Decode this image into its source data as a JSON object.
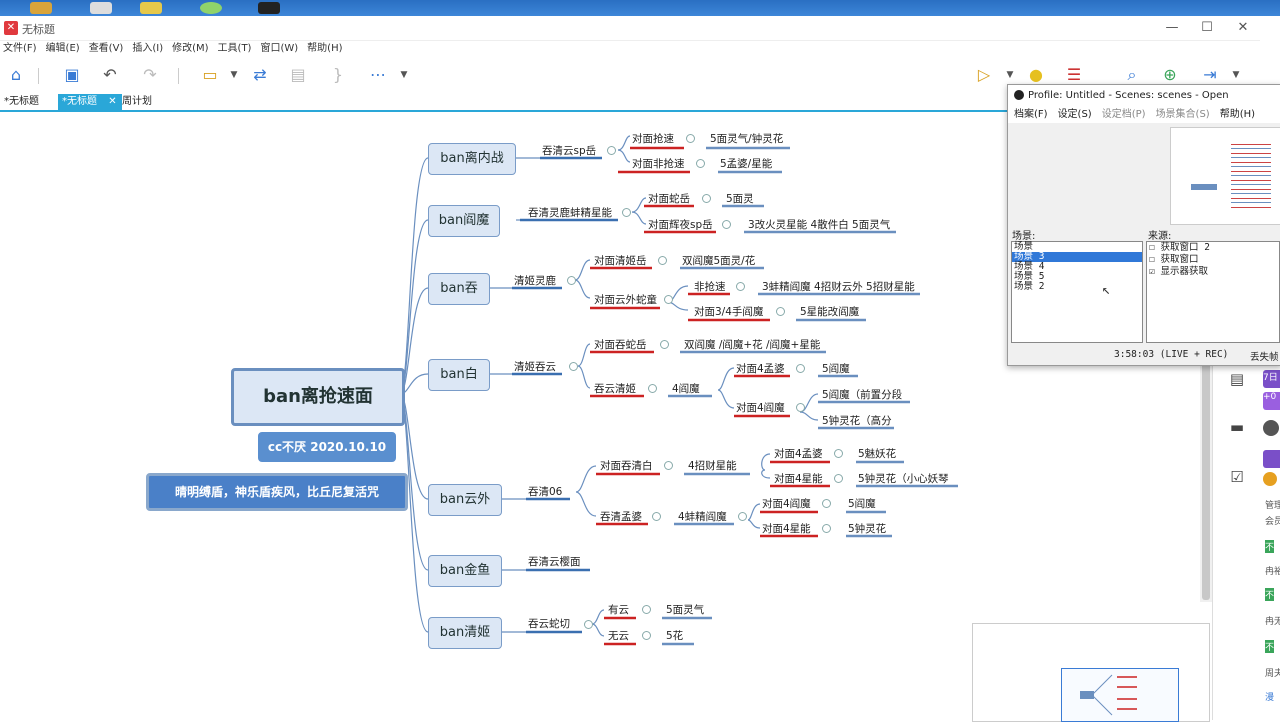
{
  "window": {
    "title": "无标题",
    "minimize": "—",
    "maximize": "☐",
    "close": "✕"
  },
  "menu": [
    "文件(F)",
    "编辑(E)",
    "查看(V)",
    "插入(I)",
    "修改(M)",
    "工具(T)",
    "窗口(W)",
    "帮助(H)"
  ],
  "tabs": [
    "*无标题",
    "*无标题",
    "周计划"
  ],
  "tab_close": "✕",
  "mindmap": {
    "root": "ban离抢速面",
    "sub1": "cc不厌 2020.10.10",
    "sub2": "晴明缚盾，神乐盾疾风，比丘尼复活咒",
    "b1": {
      "name": "ban离内战",
      "c1": "吞清云sp岳",
      "g1": "对面抢速",
      "g1v": "5面灵气/钟灵花",
      "g2": "对面非抢速",
      "g2v": "5孟婆/星能"
    },
    "b2": {
      "name": "ban阎魔",
      "c1": "吞清灵鹿蚌精星能",
      "g1": "对面蛇岳",
      "g1v": "5面灵",
      "g2": "对面辉夜sp岳",
      "g2v": "3改火灵星能 4散件白 5面灵气"
    },
    "b3": {
      "name": "ban吞",
      "c1": "清姬灵鹿",
      "g1": "对面清姬岳",
      "g1v": "双阎魔5面灵/花",
      "g2": "对面云外蛇童",
      "g2a": "非抢速",
      "g2av": "3蚌精阎魔 4招财云外 5招财星能",
      "g2b": "对面3/4手阎魔",
      "g2bv": "5星能改阎魔"
    },
    "b4": {
      "name": "ban白",
      "c1": "清姬吞云",
      "g1": "对面吞蛇岳",
      "g1v": "双阎魔 /阎魔+花 /阎魔+星能",
      "g2": "吞云清姬",
      "g2v": "4阎魔",
      "g2a": "对面4孟婆",
      "g2av": "5阎魔",
      "g2b": "对面4阎魔",
      "g2b1": "5阎魔（前置分段",
      "g2b2": "5钟灵花（高分"
    },
    "b5": {
      "name": "ban云外",
      "c1": "吞清06",
      "g1": "对面吞清白",
      "g1v": "4招财星能",
      "g1a": "对面4孟婆",
      "g1av": "5魅妖花",
      "g1b": "对面4星能",
      "g1bv": "5钟灵花（小心妖琴",
      "g2": "吞清孟婆",
      "g2v": "4蚌精阎魔",
      "g2a": "对面4阎魔",
      "g2av": "5阎魔",
      "g2b": "对面4星能",
      "g2bv": "5钟灵花"
    },
    "b6": {
      "name": "ban金鱼",
      "c1": "吞清云樱面"
    },
    "b7": {
      "name": "ban清姬",
      "c1": "吞云蛇切",
      "g1": "有云",
      "g1v": "5面灵气",
      "g2": "无云",
      "g2v": "5花"
    }
  },
  "obs": {
    "title": "Profile: Untitled - Scenes: scenes - Open Broadcaster S",
    "menu": [
      "档案(F)",
      "设定(S)",
      "设定档(P)",
      "场景集合(S)",
      "帮助(H)"
    ],
    "scenes_label": "场景:",
    "scenes": [
      "场景",
      "场景 3",
      "场景 4",
      "场景 5",
      "场景 2"
    ],
    "sources_label": "来源:",
    "sources": [
      {
        "name": "获取窗口 2",
        "checked": false
      },
      {
        "name": "获取窗口",
        "checked": false
      },
      {
        "name": "显示器获取",
        "checked": true
      }
    ],
    "status": "3:58:03 (LIVE + REC)",
    "dropped": "丢失帧"
  },
  "sidebar_partial": [
    "7日",
    "+0",
    "管理",
    "会员",
    "不",
    "冉裕",
    "不",
    "冉无",
    "不",
    "周夫",
    "漫"
  ],
  "colors": {
    "node_fill": "#dce7f5",
    "node_border": "#7a9cc8",
    "line": "#6a8fbf",
    "accent_red": "#cc2222",
    "accent_blue": "#3a7bd5"
  }
}
